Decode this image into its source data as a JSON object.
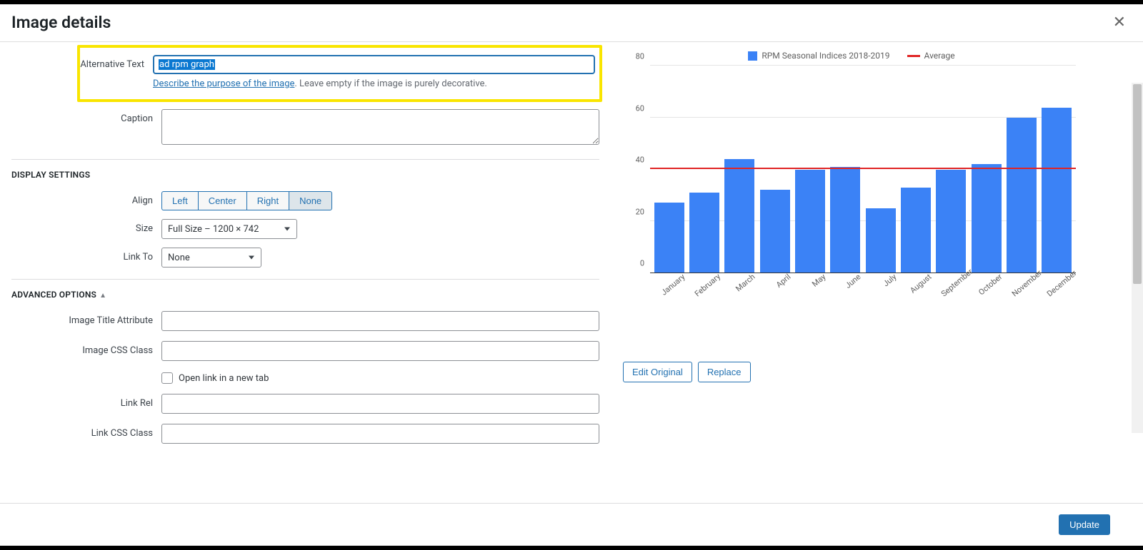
{
  "header": {
    "title": "Image details"
  },
  "fields": {
    "alt_text": {
      "label": "Alternative Text",
      "value": "ad rpm graph",
      "hint_link": "Describe the purpose of the image",
      "hint_rest": ". Leave empty if the image is purely decorative."
    },
    "caption": {
      "label": "Caption",
      "value": ""
    }
  },
  "display_settings": {
    "title": "DISPLAY SETTINGS",
    "align": {
      "label": "Align",
      "options": [
        "Left",
        "Center",
        "Right",
        "None"
      ],
      "selected": "None"
    },
    "size": {
      "label": "Size",
      "value": "Full Size – 1200 × 742"
    },
    "link_to": {
      "label": "Link To",
      "value": "None"
    }
  },
  "advanced": {
    "title": "ADVANCED OPTIONS",
    "image_title": {
      "label": "Image Title Attribute",
      "value": ""
    },
    "css_class": {
      "label": "Image CSS Class",
      "value": ""
    },
    "new_tab": {
      "label": "Open link in a new tab",
      "checked": false
    },
    "link_rel": {
      "label": "Link Rel",
      "value": ""
    },
    "link_css": {
      "label": "Link CSS Class",
      "value": ""
    }
  },
  "preview": {
    "edit_original": "Edit Original",
    "replace": "Replace"
  },
  "footer": {
    "update": "Update"
  },
  "chart_data": {
    "type": "bar",
    "categories": [
      "January",
      "February",
      "March",
      "April",
      "May",
      "June",
      "July",
      "August",
      "September",
      "October",
      "November",
      "December"
    ],
    "series": [
      {
        "name": "RPM Seasonal Indices 2018-2019",
        "values": [
          27,
          31,
          44,
          32,
          40,
          41,
          25,
          33,
          40,
          42,
          60,
          64
        ]
      }
    ],
    "average_line": {
      "name": "Average",
      "value": 40
    },
    "ylim": [
      0,
      80
    ],
    "yticks": [
      0,
      20,
      40,
      60,
      80
    ],
    "colors": {
      "bar": "#3b82f6",
      "line": "#e02424"
    }
  }
}
